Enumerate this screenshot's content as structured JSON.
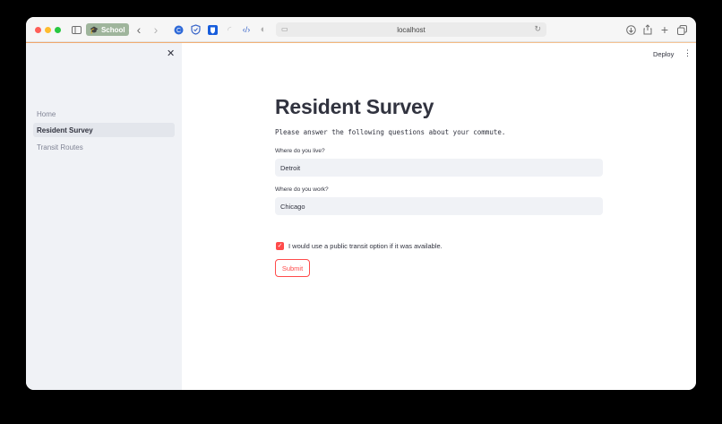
{
  "browser": {
    "group_label": "School",
    "url": "localhost",
    "icons": [
      "sidebar-icon",
      "back-icon",
      "forward-icon",
      "extension-icon",
      "shield-icon",
      "bitwarden-icon",
      "rss-icon",
      "code-icon",
      "reader-icon",
      "reload-icon",
      "download-icon",
      "share-icon",
      "new-tab-icon",
      "tabs-icon"
    ]
  },
  "app": {
    "deploy_label": "Deploy",
    "menu_icon": "⋮"
  },
  "sidebar": {
    "close_icon": "✕",
    "items": [
      {
        "label": "Home",
        "active": false
      },
      {
        "label": "Resident Survey",
        "active": true
      },
      {
        "label": "Transit Routes",
        "active": false
      }
    ]
  },
  "main": {
    "title": "Resident Survey",
    "subtitle": "Please answer the following questions about your commute.",
    "live_label": "Where do you live?",
    "live_value": "Detroit",
    "work_label": "Where do you work?",
    "work_value": "Chicago",
    "checkbox_label": "I would use a public transit option if it was available.",
    "checkbox_checked": true,
    "submit_label": "Submit"
  },
  "colors": {
    "accent": "#ff4b4b",
    "sidebar_bg": "#f0f2f6",
    "text": "#31333f"
  }
}
